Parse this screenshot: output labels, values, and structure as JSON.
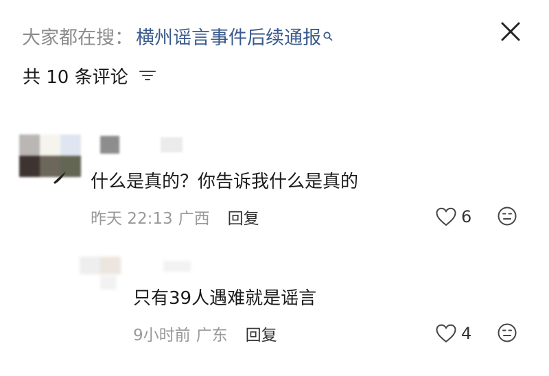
{
  "header": {
    "search_prefix": "大家都在搜：",
    "search_link": "横州谣言事件后续通报",
    "comment_count_label": "共 10 条评论"
  },
  "icons": {
    "search_mini": "search-icon",
    "close": "close-icon",
    "sort": "sort-icon",
    "like": "heart-outline-icon",
    "emoji": "emoji-face-icon"
  },
  "comments": [
    {
      "text": "什么是真的？你告诉我什么是真的",
      "time": "昨天 22:13",
      "location": "广西",
      "reply_label": "回复",
      "likes": "6"
    },
    {
      "text": "只有39人遇难就是谣言",
      "time": "9小时前",
      "location": "广东",
      "reply_label": "回复",
      "likes": "4"
    }
  ],
  "colors": {
    "link": "#3a5a8c",
    "muted": "#999999",
    "text": "#1a1a1a"
  }
}
